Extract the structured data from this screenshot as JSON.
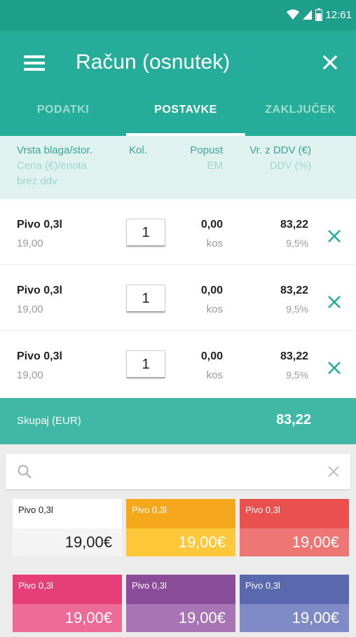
{
  "status_bar": {
    "time": "12:61"
  },
  "app_bar": {
    "title": "Račun (osnutek)"
  },
  "tabs": [
    {
      "label": "PODATKI",
      "active": false
    },
    {
      "label": "POSTAVKE",
      "active": true
    },
    {
      "label": "ZAKLJUČEK",
      "active": false
    }
  ],
  "columns": {
    "item": "Vrsta blaga/stor.",
    "item_sub_1": "Cena (€)/enota",
    "item_sub_2": "brez ddv",
    "qty": "Kol.",
    "discount": "Popust",
    "discount_sub": "EM",
    "total": "Vr. z DDV (€)",
    "total_sub": "DDV (%)"
  },
  "items": [
    {
      "name": "Pivo 0,3l",
      "price": "19,00",
      "qty": "1",
      "discount": "0,00",
      "unit": "kos",
      "total": "83,22",
      "vat": "9,5%"
    },
    {
      "name": "Pivo 0,3l",
      "price": "19,00",
      "qty": "1",
      "discount": "0,00",
      "unit": "kos",
      "total": "83,22",
      "vat": "9,5%"
    },
    {
      "name": "Pivo 0,3l",
      "price": "19,00",
      "qty": "1",
      "discount": "0,00",
      "unit": "kos",
      "total": "83,22",
      "vat": "9,5%"
    }
  ],
  "summary": {
    "label": "Skupaj (EUR)",
    "value": "83,22"
  },
  "search": {
    "placeholder": ""
  },
  "products": [
    {
      "name": "Pivo 0,3l",
      "price": "19,00€",
      "top_color": "#ffffff",
      "bottom_color": "#f4f4f4",
      "text_color": "#222222"
    },
    {
      "name": "Pivo 0,3l",
      "price": "19,00€",
      "top_color": "#f5a81c",
      "bottom_color": "#ffc73a",
      "text_color": "#ffffff"
    },
    {
      "name": "Pivo 0,3l",
      "price": "19,00€",
      "top_color": "#e8514e",
      "bottom_color": "#ee7675",
      "text_color": "#ffffff"
    },
    {
      "name": "Pivo 0,3l",
      "price": "19,00€",
      "top_color": "#e63e76",
      "bottom_color": "#ee6b98",
      "text_color": "#ffffff"
    },
    {
      "name": "Pivo 0,3l",
      "price": "19,00€",
      "top_color": "#8a4b99",
      "bottom_color": "#a874b4",
      "text_color": "#ffffff"
    },
    {
      "name": "Pivo 0,3l",
      "price": "19,00€",
      "top_color": "#5a68ae",
      "bottom_color": "#7f8bc4",
      "text_color": "#ffffff"
    }
  ],
  "colors": {
    "primary": "#26ad9a",
    "primary_dark": "#1e9f8c",
    "summary": "#3fb8a6",
    "accent": "#26ad9a"
  }
}
